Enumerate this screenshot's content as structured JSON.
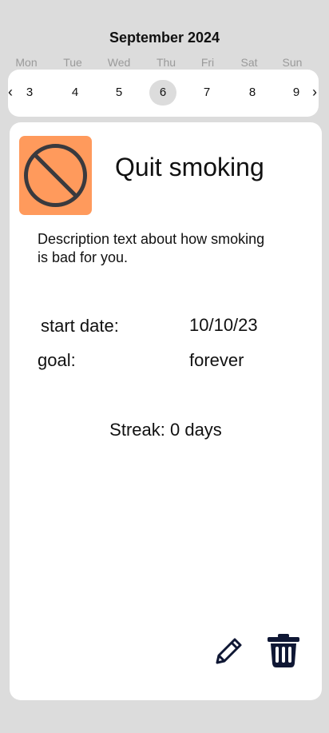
{
  "calendar": {
    "month_label": "September 2024",
    "weekdays": [
      "Mon",
      "Tue",
      "Wed",
      "Thu",
      "Fri",
      "Sat",
      "Sun"
    ],
    "days": [
      "3",
      "4",
      "5",
      "6",
      "7",
      "8",
      "9"
    ],
    "selected_day": "6",
    "prev_arrow": "‹",
    "next_arrow": "›"
  },
  "habit": {
    "icon": "no-entry-icon",
    "icon_background": "#ff9a5c",
    "title": "Quit smoking",
    "description": "Description text about how smoking is bad for you.",
    "start_date_label": "start date:",
    "start_date_value": "10/10/23",
    "goal_label": "goal:",
    "goal_value": "forever",
    "streak_text": "Streak: 0 days"
  },
  "actions": {
    "edit_icon": "pencil-icon",
    "delete_icon": "trash-icon",
    "icon_color": "#0f1734"
  }
}
